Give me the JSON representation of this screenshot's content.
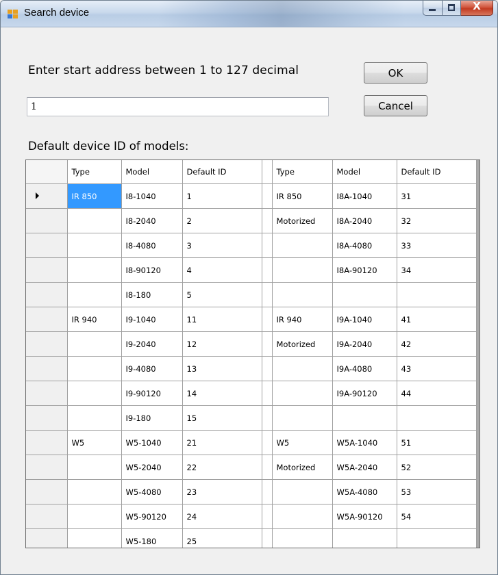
{
  "window": {
    "title": "Search device",
    "icon": "app-window-icon",
    "caption_buttons": {
      "minimize_icon": "minimize-icon",
      "maximize_icon": "maximize-icon",
      "close_label": "X"
    }
  },
  "form": {
    "prompt": "Enter start address between 1 to 127 decimal",
    "start_address_value": "1",
    "ok_label": "OK",
    "cancel_label": "Cancel"
  },
  "grid": {
    "label": "Default device ID of models:",
    "columns": [
      "Type",
      "Model",
      "Default ID",
      "Type",
      "Model",
      "Default ID"
    ],
    "current_row_icon": "row-pointer-icon",
    "selected_cell": {
      "row": 0,
      "column": 0
    },
    "rows": [
      [
        "IR 850",
        "I8-1040",
        "1",
        "IR 850",
        "I8A-1040",
        "31"
      ],
      [
        "",
        "I8-2040",
        "2",
        "Motorized",
        "I8A-2040",
        "32"
      ],
      [
        "",
        "I8-4080",
        "3",
        "",
        "I8A-4080",
        "33"
      ],
      [
        "",
        "I8-90120",
        "4",
        "",
        "I8A-90120",
        "34"
      ],
      [
        "",
        "I8-180",
        "5",
        "",
        "",
        ""
      ],
      [
        "IR 940",
        "I9-1040",
        "11",
        "IR 940",
        "I9A-1040",
        "41"
      ],
      [
        "",
        "I9-2040",
        "12",
        "Motorized",
        "I9A-2040",
        "42"
      ],
      [
        "",
        "I9-4080",
        "13",
        "",
        "I9A-4080",
        "43"
      ],
      [
        "",
        "I9-90120",
        "14",
        "",
        "I9A-90120",
        "44"
      ],
      [
        "",
        "I9-180",
        "15",
        "",
        "",
        ""
      ],
      [
        "W5",
        "W5-1040",
        "21",
        "W5",
        "W5A-1040",
        "51"
      ],
      [
        "",
        "W5-2040",
        "22",
        "Motorized",
        "W5A-2040",
        "52"
      ],
      [
        "",
        "W5-4080",
        "23",
        "",
        "W5A-4080",
        "53"
      ],
      [
        "",
        "W5-90120",
        "24",
        "",
        "W5A-90120",
        "54"
      ],
      [
        "",
        "W5-180",
        "25",
        "",
        "",
        ""
      ]
    ]
  }
}
